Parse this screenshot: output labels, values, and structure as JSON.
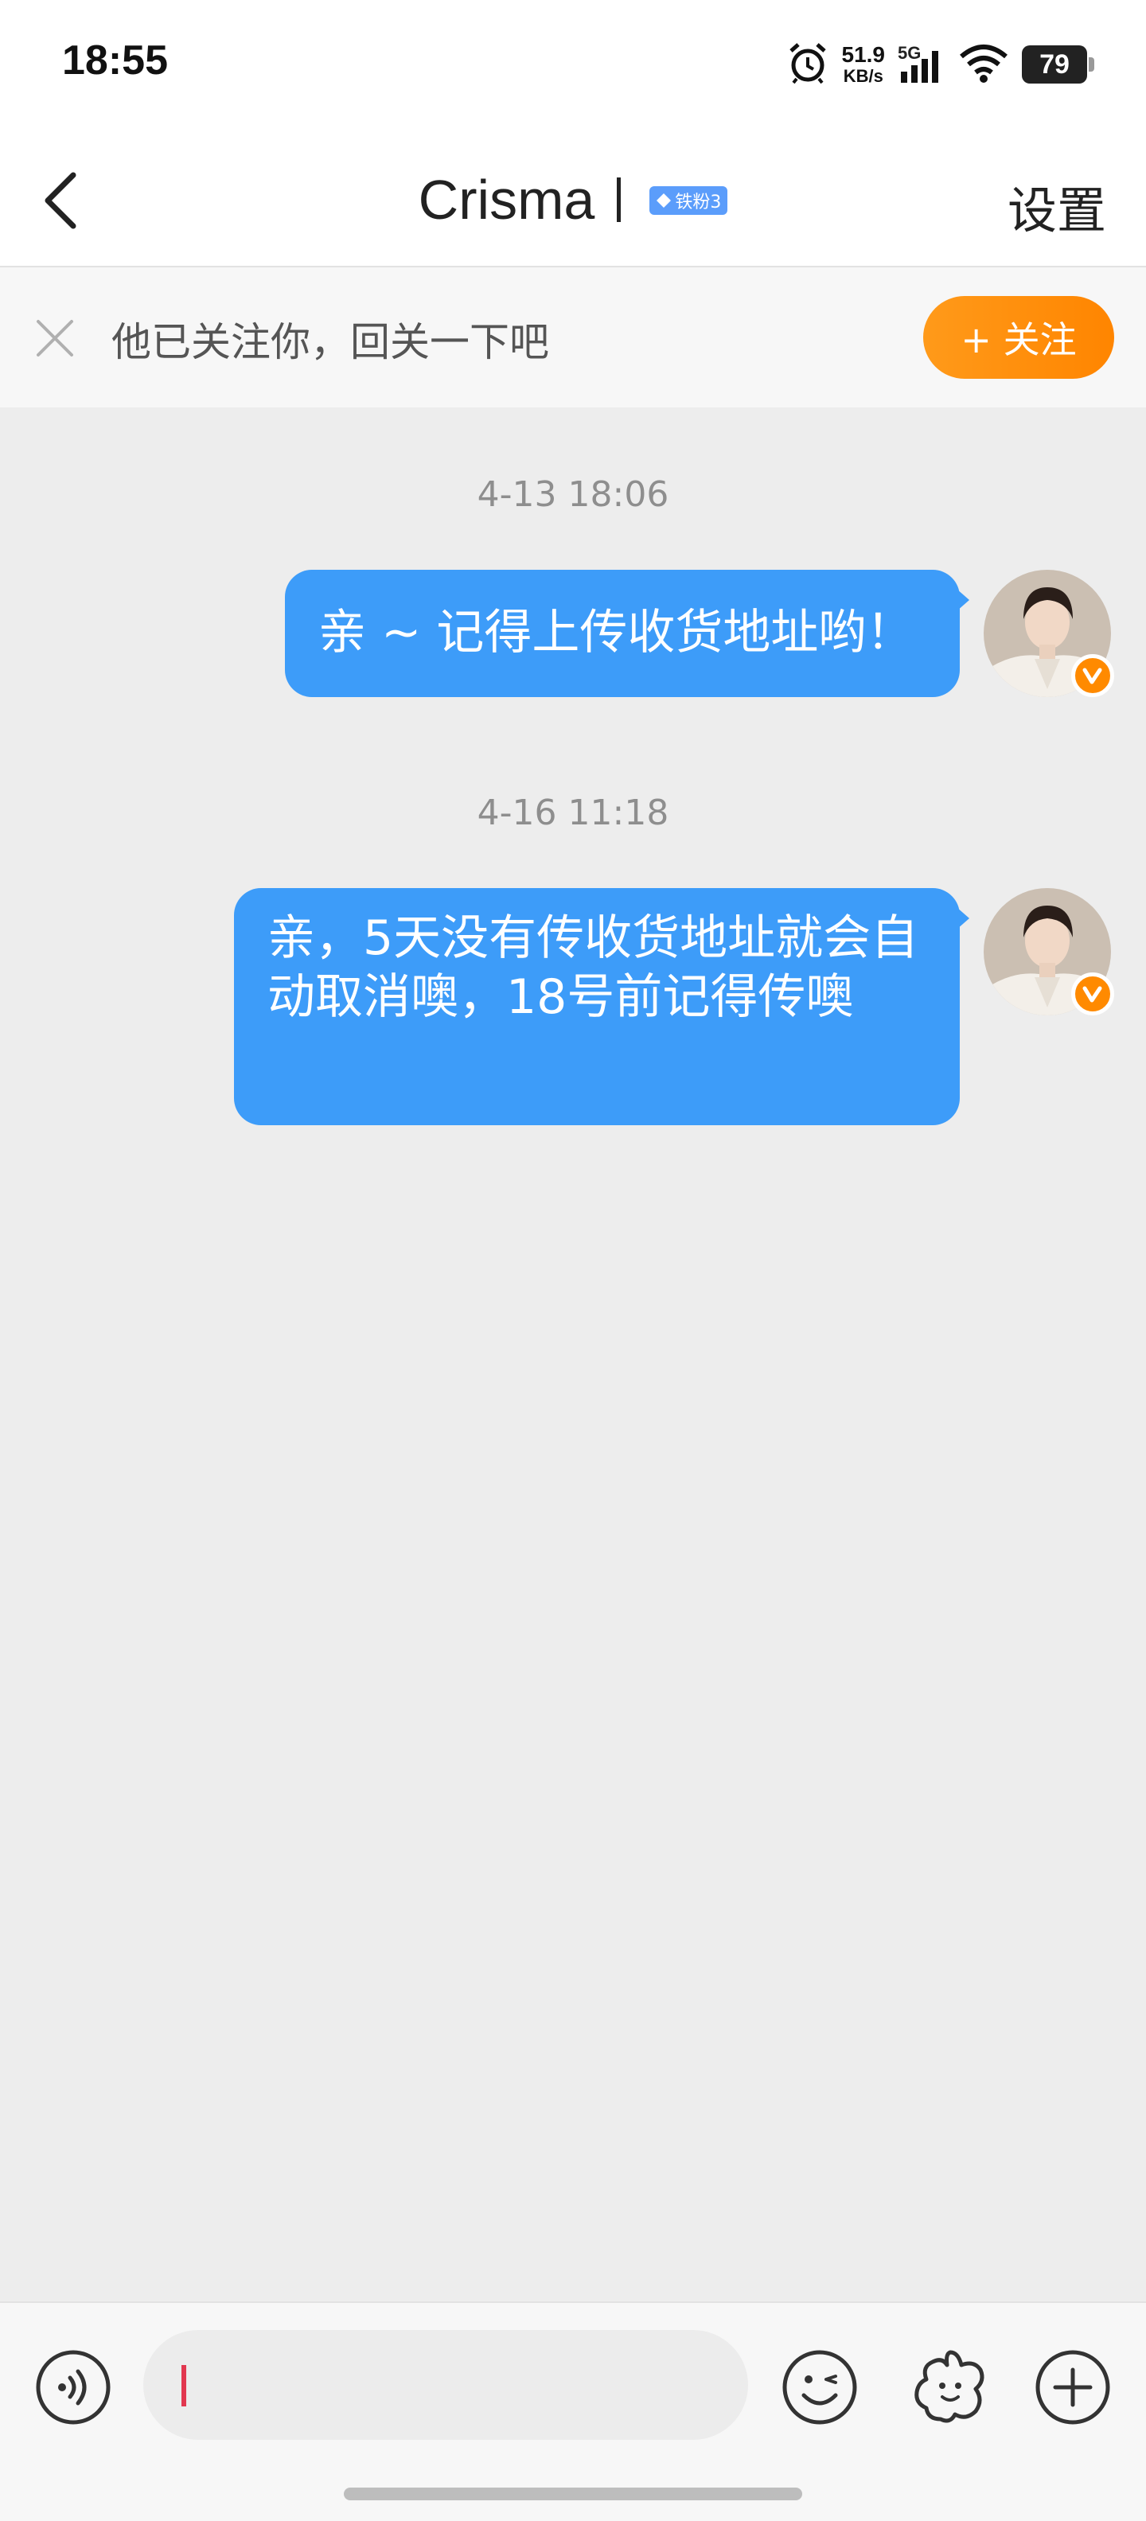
{
  "status_bar": {
    "time": "18:55",
    "net_speed_value": "51.9",
    "net_speed_unit": "KB/s",
    "network_type": "5G",
    "battery": "79",
    "icons": [
      "alarm-icon",
      "signal-icon",
      "wifi-icon",
      "battery-icon"
    ]
  },
  "nav": {
    "title": "Crisma",
    "fan_badge": "铁粉3",
    "settings": "设置",
    "icons": [
      "back-arrow-icon",
      "diamond-icon"
    ]
  },
  "follow_prompt": {
    "text": "他已关注你，回关一下吧",
    "button_label": "+ 关注",
    "icons": [
      "close-icon"
    ],
    "accent": "#ff8a00"
  },
  "chat": {
    "bubble_color": "#3d9cf9",
    "messages": [
      {
        "timestamp": "4-13 18:06",
        "text": "亲 ~ 记得上传收货地址哟！",
        "sender": "self"
      },
      {
        "timestamp": "4-16 11:18",
        "text": "亲，5天没有传收货地址就会自动取消噢，18号前记得传噢",
        "sender": "self"
      }
    ]
  },
  "input_bar": {
    "placeholder": "",
    "icons": [
      "voice-icon",
      "emoji-icon",
      "sticker-icon",
      "plus-icon"
    ]
  }
}
